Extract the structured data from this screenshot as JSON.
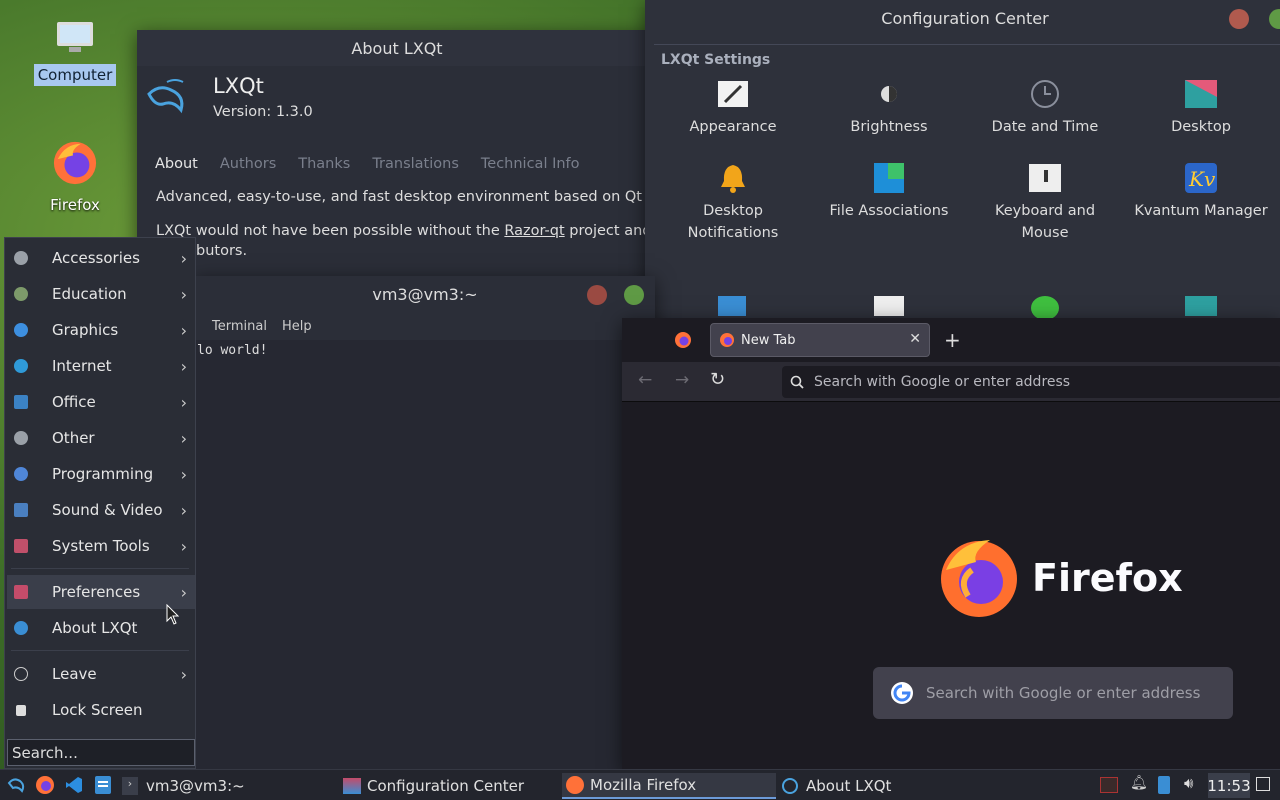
{
  "desktop": {
    "icons": [
      {
        "label": "Computer"
      },
      {
        "label": "Firefox"
      }
    ]
  },
  "about": {
    "title": "About LXQt",
    "app_name": "LXQt",
    "version": "Version: 1.3.0",
    "tabs": [
      "About",
      "Authors",
      "Thanks",
      "Translations",
      "Technical Info"
    ],
    "desc1": "Advanced, easy-to-use, and fast desktop environment based on Qt tec",
    "desc2_pre": "LXQt would not have been possible without the ",
    "desc2_link": "Razor-qt",
    "desc2_post": " project and it",
    "desc3": "butors."
  },
  "config": {
    "title": "Configuration Center",
    "section": "LXQt Settings",
    "items": [
      {
        "l1": "Appearance",
        "l2": ""
      },
      {
        "l1": "Brightness",
        "l2": ""
      },
      {
        "l1": "Date and Time",
        "l2": ""
      },
      {
        "l1": "Desktop",
        "l2": ""
      },
      {
        "l1": "Desktop",
        "l2": "Notifications"
      },
      {
        "l1": "File Associations",
        "l2": ""
      },
      {
        "l1": "Keyboard and",
        "l2": "Mouse"
      },
      {
        "l1": "Kvantum Manager",
        "l2": ""
      }
    ]
  },
  "terminal": {
    "title": "vm3@vm3:~",
    "menu": [
      "Terminal",
      "Help"
    ],
    "output": "lo world!"
  },
  "firefox": {
    "tab_title": "New Tab",
    "address_placeholder": "Search with Google or enter address",
    "brand": "Firefox",
    "search_placeholder": "Search with Google or enter address"
  },
  "menu": {
    "items": [
      {
        "label": "Accessories",
        "color": "#9aa0a8",
        "arrow": "›"
      },
      {
        "label": "Education",
        "color": "#7d9a6a",
        "arrow": "›"
      },
      {
        "label": "Graphics",
        "color": "#3d8fe0",
        "arrow": "›"
      },
      {
        "label": "Internet",
        "color": "#2f9ad8",
        "arrow": "›"
      },
      {
        "label": "Office",
        "color": "#3b82c4",
        "arrow": "›"
      },
      {
        "label": "Other",
        "color": "#9aa0a8",
        "arrow": "›"
      },
      {
        "label": "Programming",
        "color": "#4f86d8",
        "arrow": "›"
      },
      {
        "label": "Sound & Video",
        "color": "#4a7fc0",
        "arrow": "›"
      },
      {
        "label": "System Tools",
        "color": "#c0506a",
        "arrow": "›"
      },
      {
        "label": "Preferences",
        "color": "#c44c6a",
        "arrow": "›"
      },
      {
        "label": "About LXQt",
        "color": "#3a8ed4",
        "arrow": ""
      },
      {
        "label": "Leave",
        "color": "#cccccc",
        "arrow": "›"
      },
      {
        "label": "Lock Screen",
        "color": "#dddddd",
        "arrow": ""
      }
    ],
    "search_placeholder": "Search..."
  },
  "taskbar": {
    "tasks": [
      "vm3@vm3:~",
      "Configuration Center",
      "Mozilla Firefox",
      "About LXQt"
    ],
    "clock": "11:53"
  }
}
